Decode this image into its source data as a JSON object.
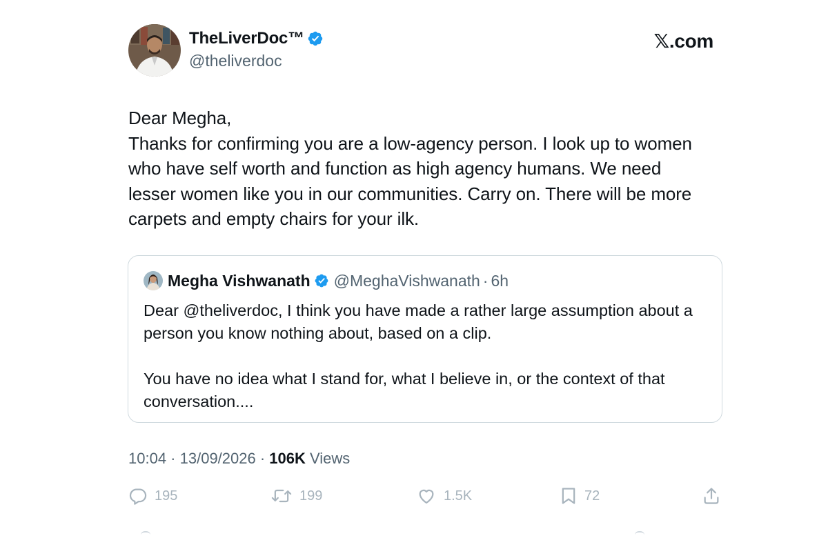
{
  "brand": "𝕏.com",
  "author": {
    "name": "TheLiverDoc™",
    "handle": "@theliverdoc",
    "verified": true,
    "avatar_icon": "profile-photo-icon"
  },
  "tweet": {
    "lines": [
      "Dear Megha,",
      "Thanks for confirming you are a low-agency person. I look up to women",
      "who have self worth and function as high agency humans. We need",
      "lesser women like you in our communities. Carry on. There will be more",
      "carpets and empty chairs for your ilk."
    ]
  },
  "quoted": {
    "name": "Megha Vishwanath",
    "handle": "@MeghaVishwanath",
    "separator": "·",
    "time": "6h",
    "verified": true,
    "paragraph1": [
      "Dear @theliverdoc, I think you have made a rather large assumption about a",
      "person you know nothing about, based on a clip."
    ],
    "paragraph2": [
      "You have no idea what I stand for, what I believe in, or the context of that",
      "conversation...."
    ]
  },
  "meta": {
    "time": "10:04",
    "sep1": " · ",
    "date": "13/09/2026",
    "sep2": " · ",
    "views_count": "106K",
    "views_label": " Views"
  },
  "actions": {
    "replies": "195",
    "reposts": "199",
    "likes": "1.5K",
    "bookmarks": "72"
  },
  "colors": {
    "text": "#0f1419",
    "secondary": "#536471",
    "verified_blue": "#1d9bf0",
    "border": "#cfd9de",
    "action_icons": "#a8b4bd"
  }
}
